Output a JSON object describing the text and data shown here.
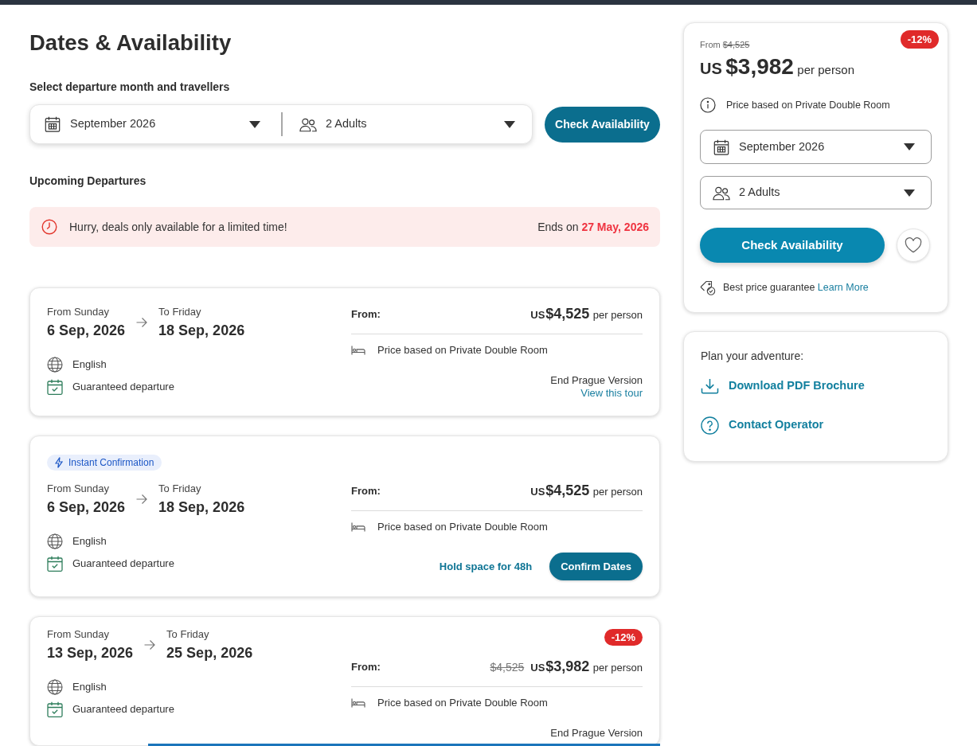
{
  "header": {
    "title": "Dates & Availability",
    "subtitle": "Select departure month and travellers"
  },
  "search_bar": {
    "month": "September 2026",
    "travellers": "2 Adults",
    "button": "Check Availability"
  },
  "departures": {
    "heading": "Upcoming Departures",
    "alert": {
      "message": "Hurry, deals only available for a limited time!",
      "ends_label": "Ends on",
      "ends_date": "27 May, 2026"
    },
    "cards": [
      {
        "start_label": "From Sunday",
        "start_date": "6 Sep, 2026",
        "end_label": "To Friday",
        "end_date": "18 Sep, 2026",
        "features": [
          {
            "kind": "language",
            "text": "English"
          },
          {
            "kind": "guaranteed",
            "text": "Guaranteed departure"
          }
        ],
        "price_label": "From:",
        "currency": "US",
        "price": "$4,525",
        "price_unit": "per person",
        "room_note": "Price based on Private Double Room",
        "footer": {
          "kind": "version",
          "version": "End Prague Version",
          "link": "View this tour"
        }
      },
      {
        "badge": "Instant Confirmation",
        "start_label": "From Sunday",
        "start_date": "6 Sep, 2026",
        "end_label": "To Friday",
        "end_date": "18 Sep, 2026",
        "features": [
          {
            "kind": "language",
            "text": "English"
          },
          {
            "kind": "guaranteed",
            "text": "Guaranteed departure"
          }
        ],
        "price_label": "From:",
        "currency": "US",
        "price": "$4,525",
        "price_unit": "per person",
        "room_note": "Price based on Private Double Room",
        "footer": {
          "kind": "hold",
          "link": "Hold space for 48h",
          "button": "Confirm Dates"
        }
      },
      {
        "discount": "-12%",
        "start_label": "From Sunday",
        "start_date": "13 Sep, 2026",
        "end_label": "To Friday",
        "end_date": "25 Sep, 2026",
        "features": [
          {
            "kind": "language",
            "text": "English"
          },
          {
            "kind": "guaranteed",
            "text": "Guaranteed departure"
          }
        ],
        "price_label": "From:",
        "old_price": "$4,525",
        "currency": "US",
        "price": "$3,982",
        "price_unit": "per person",
        "room_note": "Price based on Private Double Room",
        "footer": {
          "kind": "version",
          "version": "End Prague Version"
        }
      }
    ]
  },
  "sidebar": {
    "price_card": {
      "from_label": "From",
      "old_price": "$4,525",
      "discount": "-12%",
      "currency": "US",
      "price": "$3,982",
      "price_unit": "per person",
      "room_note": "Price based on Private Double Room",
      "month": "September 2026",
      "travellers": "2 Adults",
      "button": "Check Availability",
      "guarantee": "Best price guarantee",
      "guarantee_link": "Learn More"
    },
    "plan_card": {
      "heading": "Plan your adventure:",
      "links": [
        {
          "kind": "download",
          "label": "Download PDF Brochure"
        },
        {
          "kind": "contact",
          "label": "Contact Operator"
        }
      ]
    }
  }
}
